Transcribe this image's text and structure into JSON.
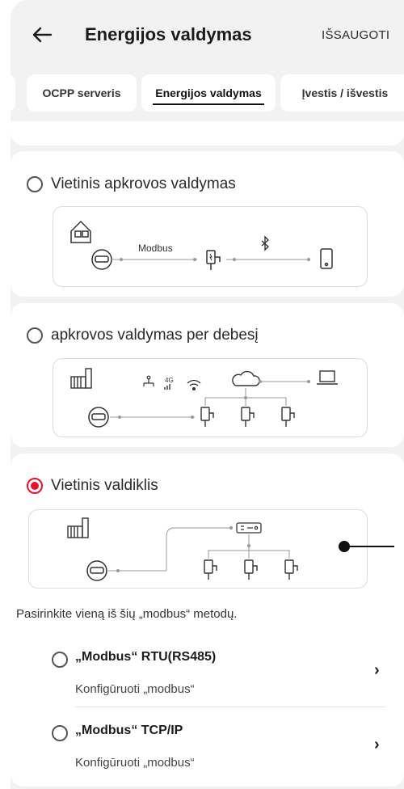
{
  "header": {
    "title": "Energijos valdymas",
    "save_label": "IŠSAUGOTI"
  },
  "tabs": [
    {
      "label": "OCPP serveris",
      "active": false
    },
    {
      "label": "Energijos valdymas",
      "active": true
    },
    {
      "label": "Įvestis / išvestis",
      "active": false
    }
  ],
  "options": [
    {
      "label": "Vietinis apkrovos valdymas",
      "selected": false,
      "diagram": {
        "modbus_label": "Modbus"
      }
    },
    {
      "label": "apkrovos valdymas per debesį",
      "selected": false,
      "diagram": {
        "net_4g": "4G"
      }
    },
    {
      "label": "Vietinis valdiklis",
      "selected": true
    }
  ],
  "modbus_section": {
    "hint": "Pasirinkite vieną iš šių „modbus“ metodų.",
    "methods": [
      {
        "label": "„Modbus“ RTU(RS485)",
        "sub": "Konfigūruoti „modbus“",
        "selected": false
      },
      {
        "label": "„Modbus“ TCP/IP",
        "sub": "Konfigūruoti „modbus“",
        "selected": false
      }
    ]
  },
  "colors": {
    "accent": "#e8112d",
    "background": "#f2f2f2",
    "card": "#ffffff"
  }
}
